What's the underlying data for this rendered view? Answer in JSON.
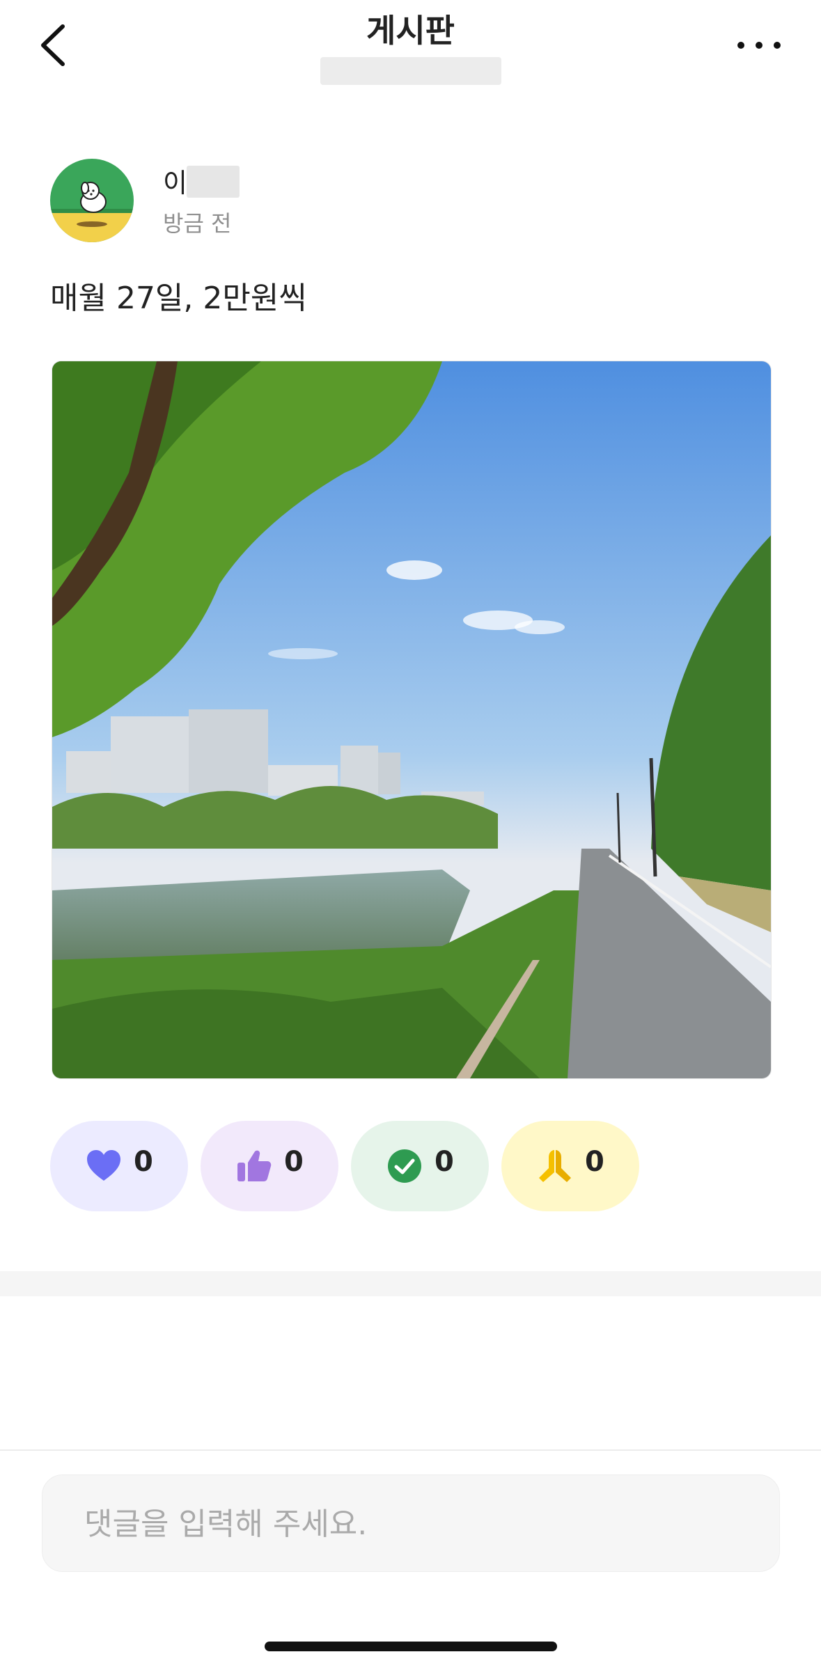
{
  "header": {
    "title": "게시판",
    "back_icon": "chevron-left-icon",
    "more_icon": "more-horizontal-icon"
  },
  "post": {
    "author_visible": "이",
    "time": "방금 전",
    "body": "매월 27일, 2만원씩"
  },
  "reactions": [
    {
      "icon": "heart-icon",
      "count": "0",
      "bg": "#ecebff",
      "color": "#6b6ef5"
    },
    {
      "icon": "thumbs-up-icon",
      "count": "0",
      "bg": "#f2e9fb",
      "color": "#a176e0"
    },
    {
      "icon": "check-circle-icon",
      "count": "0",
      "bg": "#e6f4ea",
      "color": "#2e9b51"
    },
    {
      "icon": "praying-hands-icon",
      "count": "0",
      "bg": "#fff8c8",
      "color": "#f5c000"
    }
  ],
  "comment": {
    "placeholder": "댓글을 입력해 주세요."
  }
}
